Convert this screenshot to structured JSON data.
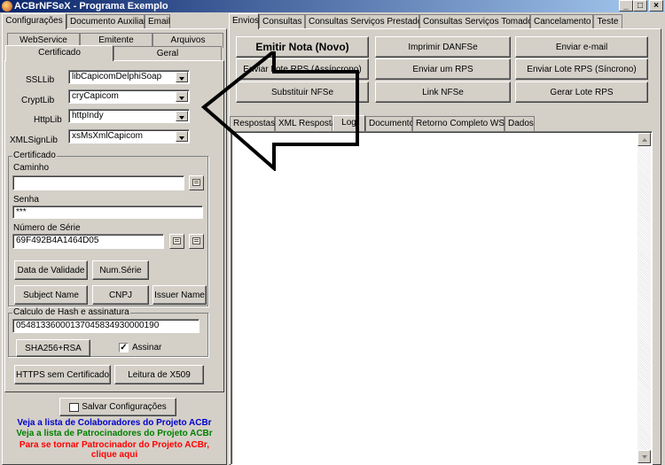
{
  "window": {
    "title": "ACBrNFSeX - Programa Exemplo",
    "minimize": "_",
    "maximize": "□",
    "close": "×"
  },
  "left_tabs": [
    "Configurações",
    "Documento Auxiliar",
    "Email"
  ],
  "config_tabs_row1": [
    "WebService",
    "Emitente",
    "Arquivos"
  ],
  "config_tabs_row2": [
    "Certificado",
    "Geral"
  ],
  "libs": [
    {
      "label": "SSLLib",
      "value": "libCapicomDelphiSoap"
    },
    {
      "label": "CryptLib",
      "value": "cryCapicom"
    },
    {
      "label": "HttpLib",
      "value": "httpIndy"
    },
    {
      "label": "XMLSignLib",
      "value": "xsMsXmlCapicom"
    }
  ],
  "certificado": {
    "title": "Certificado",
    "caminho_label": "Caminho",
    "caminho_value": "",
    "senha_label": "Senha",
    "senha_value": "***",
    "serie_label": "Número de Série",
    "serie_value": "69F492B4A1464D05"
  },
  "cert_buttons": {
    "data_validade": "Data de Validade",
    "num_serie": "Num.Série",
    "subject_name": "Subject Name",
    "cnpj": "CNPJ",
    "issuer_name": "Issuer Name"
  },
  "hash": {
    "title": "Calculo de Hash e assinatura",
    "value": "05481336000137045834930000190",
    "algo_button": "SHA256+RSA",
    "assinar_label": "Assinar",
    "assinar_checked": true
  },
  "bottom_buttons": {
    "https": "HTTPS sem Certificado",
    "x509": "Leitura de X509"
  },
  "salvar": "Salvar Configurações",
  "links": [
    {
      "text": "Veja a lista de Colaboradores do Projeto ACBr",
      "color": "#0000cc"
    },
    {
      "text": "Veja a lista de Patrocinadores do Projeto ACBr",
      "color": "#008000"
    },
    {
      "text": "Para se tornar Patrocinador do Projeto ACBr,",
      "color": "#ff0000"
    },
    {
      "text": "clique aqui",
      "color": "#ff0000"
    }
  ],
  "right_tabs": [
    "Envios",
    "Consultas",
    "Consultas Serviços Prestados",
    "Consultas Serviços Tomados",
    "Cancelamento",
    "Teste"
  ],
  "envios_buttons": [
    [
      "Emitir Nota (Novo)",
      "Imprimir DANFSe",
      "Enviar e-mail"
    ],
    [
      "Enviar Lote RPS (Assíncrono)",
      "Enviar um RPS",
      "Enviar Lote RPS (Síncrono)"
    ],
    [
      "Substituir NFSe",
      "Link NFSe",
      "Gerar Lote RPS"
    ]
  ],
  "result_tabs": [
    "Respostas",
    "XML Resposta",
    "Log",
    "Documento",
    "Retorno Completo WS",
    "Dados"
  ]
}
